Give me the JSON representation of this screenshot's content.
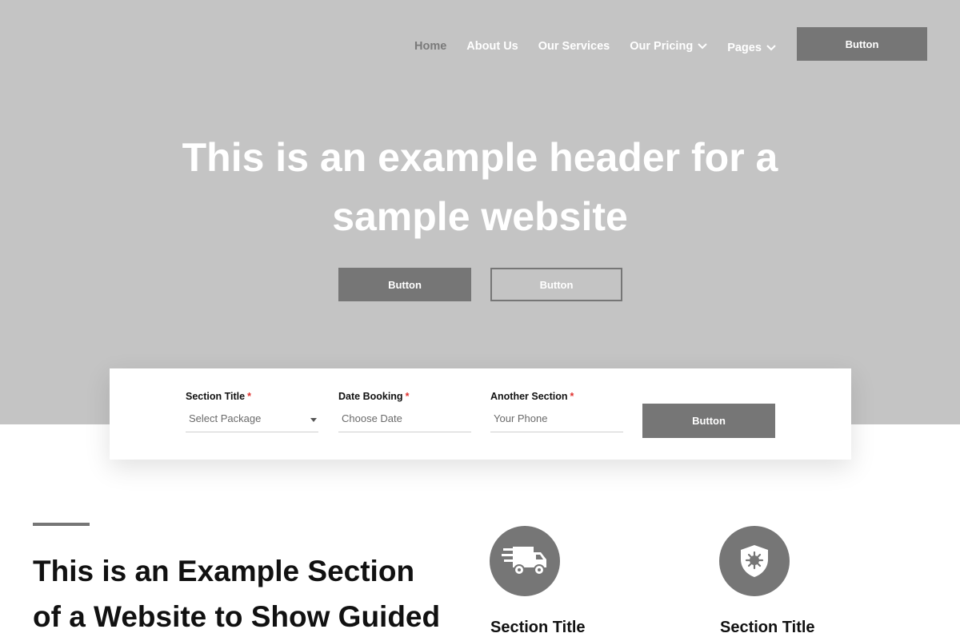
{
  "nav": {
    "items": [
      {
        "label": "Home",
        "active": true,
        "dropdown": false
      },
      {
        "label": "About Us",
        "active": false,
        "dropdown": false
      },
      {
        "label": "Our Services",
        "active": false,
        "dropdown": false
      },
      {
        "label": "Our Pricing",
        "active": false,
        "dropdown": true
      },
      {
        "label": "Pages",
        "active": false,
        "dropdown": true
      }
    ],
    "cta_label": "Button"
  },
  "hero": {
    "title": "This is an example header for a sample website",
    "primary_button": "Button",
    "secondary_button": "Button"
  },
  "booking": {
    "fields": [
      {
        "label": "Section Title",
        "required": "*",
        "value": "Select Package",
        "type": "select"
      },
      {
        "label": "Date Booking",
        "required": "*",
        "value": "Choose Date",
        "type": "date"
      },
      {
        "label": "Another Section",
        "required": "*",
        "value": "Your Phone",
        "type": "text"
      }
    ],
    "submit_label": "Button"
  },
  "section": {
    "heading": "This is an Example Section of a Website to Show Guided"
  },
  "features": [
    {
      "icon": "delivery-truck-icon",
      "title": "Section Title"
    },
    {
      "icon": "shield-virus-icon",
      "title": "Section Title"
    }
  ],
  "colors": {
    "hero_bg": "#c4c4c4",
    "button_bg": "#767676",
    "required_mark": "#e0312e"
  }
}
